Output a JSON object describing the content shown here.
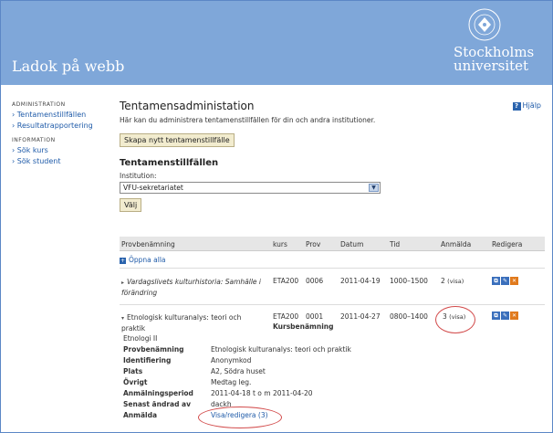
{
  "app": {
    "title": "Ladok på webb"
  },
  "logo": {
    "line1": "Stockholms",
    "line2": "universitet",
    "seal_text": "STOCKHOLMS UNIVERSITET"
  },
  "sidebar": {
    "sections": [
      {
        "heading": "ADMINISTRATION",
        "items": [
          "Tentamenstillfällen",
          "Resultatrapportering"
        ]
      },
      {
        "heading": "INFORMATION",
        "items": [
          "Sök kurs",
          "Sök student"
        ]
      }
    ]
  },
  "help": {
    "label": "Hjälp",
    "icon": "help-icon"
  },
  "page": {
    "title": "Tentamensadministation",
    "intro": "Här kan du administrera tentamenstillfällen för din och andra institutioner.",
    "create_button": "Skapa nytt tentamenstillfälle",
    "section_title": "Tentamenstillfällen",
    "institution_label": "Institution:",
    "institution_value": "VFU-sekretariatet",
    "choose_button": "Välj"
  },
  "table": {
    "headers": {
      "name": "Provbenämning",
      "course": "kurs",
      "exam": "Prov",
      "date": "Datum",
      "time": "Tid",
      "registered": "Anmälda",
      "edit": "Redigera"
    },
    "open_all": "Öppna alla",
    "rows": [
      {
        "name_line1": "Vardagslivets kulturhistoria: Samhälle i",
        "name_line2": "förändring",
        "course": "ETA200",
        "exam": "0006",
        "date": "2011-04-19",
        "time": "1000–1500",
        "registered": "2",
        "visa": "(visa)"
      },
      {
        "name_line1": "Etnologisk kulturanalys: teori och",
        "name_line2": "praktik",
        "course": "ETA200",
        "exam": "0001",
        "date": "2011-04-27",
        "time": "0800–1400",
        "registered": "3",
        "visa": "(visa)",
        "sub": "Kursbenämning"
      }
    ],
    "detail": {
      "course_name": "Etnologi II",
      "items": [
        {
          "label": "Provbenämning",
          "value": "Etnologisk kulturanalys: teori och praktik"
        },
        {
          "label": "Identifiering",
          "value": "Anonymkod"
        },
        {
          "label": "Plats",
          "value": "A2, Södra huset"
        },
        {
          "label": "Övrigt",
          "value": "Medtag leg."
        },
        {
          "label": "Anmälningsperiod",
          "value": "2011-04-18 t o m 2011-04-20"
        },
        {
          "label": "Senast ändrad av",
          "value": "dackh"
        },
        {
          "label": "Anmälda",
          "value": "Visa/redigera (3)"
        }
      ]
    }
  },
  "colors": {
    "header": "#7fa7d9",
    "link": "#1e5aa8",
    "orange": "#d07a1a",
    "annotation": "#d24a4a"
  }
}
